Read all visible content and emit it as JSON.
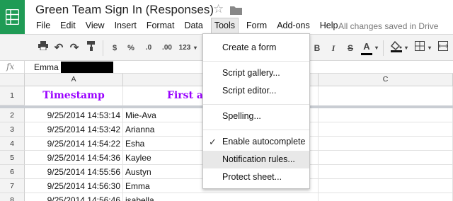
{
  "document": {
    "title": "Green Team Sign In (Responses)",
    "save_status": "All changes saved in Drive"
  },
  "menu": [
    {
      "label": "File"
    },
    {
      "label": "Edit"
    },
    {
      "label": "View"
    },
    {
      "label": "Insert"
    },
    {
      "label": "Format"
    },
    {
      "label": "Data"
    },
    {
      "label": "Tools",
      "active": true
    },
    {
      "label": "Form"
    },
    {
      "label": "Add-ons"
    },
    {
      "label": "Help"
    }
  ],
  "toolbar": {
    "currency_label": "$",
    "percent_label": "%",
    "decrease_decimals_label": ".0",
    "increase_decimals_label": ".00",
    "more_formats_label": "123",
    "bold_label": "B",
    "italic_label": "I",
    "strikethrough_label": "S",
    "text_color_label": "A",
    "icons": [
      "print-icon",
      "undo-icon",
      "redo-icon",
      "paint-format-icon",
      "fill-color-icon",
      "borders-icon",
      "merge-cells-icon"
    ]
  },
  "formula_bar": {
    "fx_label": "fx",
    "value": "Emma"
  },
  "grid": {
    "columns": [
      "A",
      "",
      "C"
    ],
    "row_numbers": [
      "1",
      "2",
      "3",
      "4",
      "5",
      "6",
      "7",
      "8"
    ],
    "header_row": {
      "timestamp": "Timestamp",
      "first_name": "First a"
    },
    "rows": [
      {
        "timestamp": "9/25/2014 14:53:14",
        "name": "Mie-Ava"
      },
      {
        "timestamp": "9/25/2014 14:53:42",
        "name": "Arianna"
      },
      {
        "timestamp": "9/25/2014 14:54:22",
        "name": "Esha"
      },
      {
        "timestamp": "9/25/2014 14:54:36",
        "name": "Kaylee"
      },
      {
        "timestamp": "9/25/2014 14:55:56",
        "name": "Austyn"
      },
      {
        "timestamp": "9/25/2014 14:56:30",
        "name": "Emma"
      },
      {
        "timestamp": "9/25/2014 14:56:46",
        "name": "isabella"
      }
    ]
  },
  "tools_menu": {
    "items": [
      {
        "label": "Create a form"
      },
      {
        "label": "Script gallery..."
      },
      {
        "label": "Script editor..."
      },
      {
        "label": "Spelling..."
      },
      {
        "label": "Enable autocomplete",
        "checked": true
      },
      {
        "label": "Notification rules...",
        "highlighted": true
      },
      {
        "label": "Protect sheet..."
      }
    ],
    "check_glyph": "✓"
  },
  "colors": {
    "brand_green": "#1f9b55",
    "header_text_purple": "#9900ff",
    "menu_highlight": "#e8e8e8"
  }
}
